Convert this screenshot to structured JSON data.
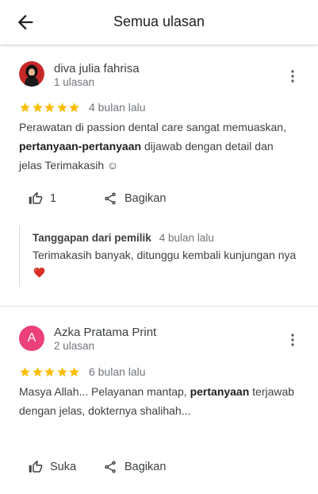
{
  "header": {
    "title": "Semua ulasan",
    "back_icon": "arrow-back-icon"
  },
  "reviews": [
    {
      "author": "diva julia fahrisa",
      "author_meta": "1 ulasan",
      "avatar": "photo",
      "rating": 5,
      "time_ago": "4 bulan lalu",
      "text": {
        "part1": "Perawatan di passion dental care sangat memuaskan, ",
        "bold": "pertanyaan-pertanyaan",
        "part2": " dijawab dengan detail dan jelas Terimakasih ☺"
      },
      "like_count": "1",
      "share_label": "Bagikan",
      "owner_reply": {
        "title": "Tanggapan dari pemilik",
        "time_ago": "4 bulan lalu",
        "text": "Terimakasih banyak, ditunggu kembali kunjungan nya",
        "emoji": "heart-icon"
      }
    },
    {
      "author": "Azka Pratama Print",
      "author_meta": "2 ulasan",
      "avatar_letter": "A",
      "rating": 5,
      "time_ago": "6 bulan lalu",
      "text": {
        "part1": "Masya Allah... Pelayanan mantap, ",
        "bold": "pertanyaan",
        "part2": " terjawab dengan jelas, dokternya shalihah..."
      },
      "like_label": "Suka",
      "share_label": "Bagikan"
    }
  ],
  "colors": {
    "star": "#fbbc04",
    "avatar_letter_bg": "#ec407a",
    "heart": "#d93025",
    "divider": "#dadce0",
    "muted_text": "#70757a"
  }
}
